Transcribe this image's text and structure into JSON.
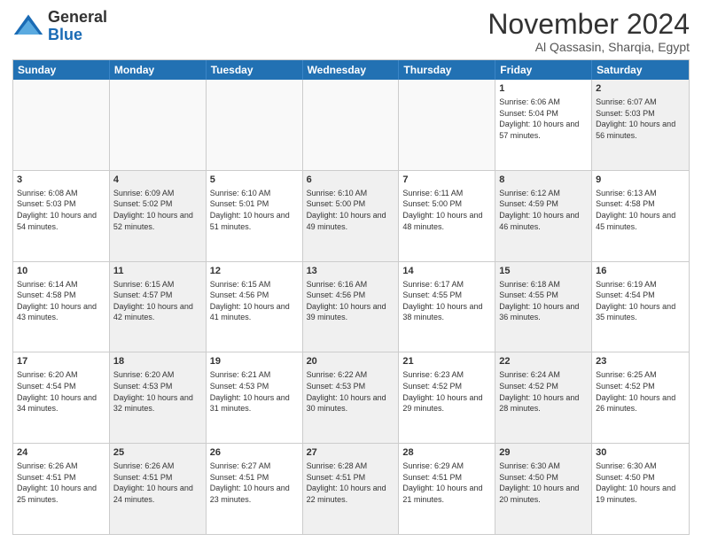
{
  "header": {
    "logo": {
      "general": "General",
      "blue": "Blue"
    },
    "title": "November 2024",
    "subtitle": "Al Qassasin, Sharqia, Egypt"
  },
  "days": [
    "Sunday",
    "Monday",
    "Tuesday",
    "Wednesday",
    "Thursday",
    "Friday",
    "Saturday"
  ],
  "rows": [
    [
      {
        "day": "",
        "empty": true
      },
      {
        "day": "",
        "empty": true
      },
      {
        "day": "",
        "empty": true
      },
      {
        "day": "",
        "empty": true
      },
      {
        "day": "",
        "empty": true
      },
      {
        "day": "1",
        "sunrise": "6:06 AM",
        "sunset": "5:04 PM",
        "daylight": "10 hours and 57 minutes."
      },
      {
        "day": "2",
        "sunrise": "6:07 AM",
        "sunset": "5:03 PM",
        "daylight": "10 hours and 56 minutes.",
        "shaded": true
      }
    ],
    [
      {
        "day": "3",
        "sunrise": "6:08 AM",
        "sunset": "5:03 PM",
        "daylight": "10 hours and 54 minutes."
      },
      {
        "day": "4",
        "sunrise": "6:09 AM",
        "sunset": "5:02 PM",
        "daylight": "10 hours and 52 minutes.",
        "shaded": true
      },
      {
        "day": "5",
        "sunrise": "6:10 AM",
        "sunset": "5:01 PM",
        "daylight": "10 hours and 51 minutes."
      },
      {
        "day": "6",
        "sunrise": "6:10 AM",
        "sunset": "5:00 PM",
        "daylight": "10 hours and 49 minutes.",
        "shaded": true
      },
      {
        "day": "7",
        "sunrise": "6:11 AM",
        "sunset": "5:00 PM",
        "daylight": "10 hours and 48 minutes."
      },
      {
        "day": "8",
        "sunrise": "6:12 AM",
        "sunset": "4:59 PM",
        "daylight": "10 hours and 46 minutes.",
        "shaded": true
      },
      {
        "day": "9",
        "sunrise": "6:13 AM",
        "sunset": "4:58 PM",
        "daylight": "10 hours and 45 minutes."
      }
    ],
    [
      {
        "day": "10",
        "sunrise": "6:14 AM",
        "sunset": "4:58 PM",
        "daylight": "10 hours and 43 minutes."
      },
      {
        "day": "11",
        "sunrise": "6:15 AM",
        "sunset": "4:57 PM",
        "daylight": "10 hours and 42 minutes.",
        "shaded": true
      },
      {
        "day": "12",
        "sunrise": "6:15 AM",
        "sunset": "4:56 PM",
        "daylight": "10 hours and 41 minutes."
      },
      {
        "day": "13",
        "sunrise": "6:16 AM",
        "sunset": "4:56 PM",
        "daylight": "10 hours and 39 minutes.",
        "shaded": true
      },
      {
        "day": "14",
        "sunrise": "6:17 AM",
        "sunset": "4:55 PM",
        "daylight": "10 hours and 38 minutes."
      },
      {
        "day": "15",
        "sunrise": "6:18 AM",
        "sunset": "4:55 PM",
        "daylight": "10 hours and 36 minutes.",
        "shaded": true
      },
      {
        "day": "16",
        "sunrise": "6:19 AM",
        "sunset": "4:54 PM",
        "daylight": "10 hours and 35 minutes."
      }
    ],
    [
      {
        "day": "17",
        "sunrise": "6:20 AM",
        "sunset": "4:54 PM",
        "daylight": "10 hours and 34 minutes."
      },
      {
        "day": "18",
        "sunrise": "6:20 AM",
        "sunset": "4:53 PM",
        "daylight": "10 hours and 32 minutes.",
        "shaded": true
      },
      {
        "day": "19",
        "sunrise": "6:21 AM",
        "sunset": "4:53 PM",
        "daylight": "10 hours and 31 minutes."
      },
      {
        "day": "20",
        "sunrise": "6:22 AM",
        "sunset": "4:53 PM",
        "daylight": "10 hours and 30 minutes.",
        "shaded": true
      },
      {
        "day": "21",
        "sunrise": "6:23 AM",
        "sunset": "4:52 PM",
        "daylight": "10 hours and 29 minutes."
      },
      {
        "day": "22",
        "sunrise": "6:24 AM",
        "sunset": "4:52 PM",
        "daylight": "10 hours and 28 minutes.",
        "shaded": true
      },
      {
        "day": "23",
        "sunrise": "6:25 AM",
        "sunset": "4:52 PM",
        "daylight": "10 hours and 26 minutes."
      }
    ],
    [
      {
        "day": "24",
        "sunrise": "6:26 AM",
        "sunset": "4:51 PM",
        "daylight": "10 hours and 25 minutes."
      },
      {
        "day": "25",
        "sunrise": "6:26 AM",
        "sunset": "4:51 PM",
        "daylight": "10 hours and 24 minutes.",
        "shaded": true
      },
      {
        "day": "26",
        "sunrise": "6:27 AM",
        "sunset": "4:51 PM",
        "daylight": "10 hours and 23 minutes."
      },
      {
        "day": "27",
        "sunrise": "6:28 AM",
        "sunset": "4:51 PM",
        "daylight": "10 hours and 22 minutes.",
        "shaded": true
      },
      {
        "day": "28",
        "sunrise": "6:29 AM",
        "sunset": "4:51 PM",
        "daylight": "10 hours and 21 minutes."
      },
      {
        "day": "29",
        "sunrise": "6:30 AM",
        "sunset": "4:50 PM",
        "daylight": "10 hours and 20 minutes.",
        "shaded": true
      },
      {
        "day": "30",
        "sunrise": "6:30 AM",
        "sunset": "4:50 PM",
        "daylight": "10 hours and 19 minutes."
      }
    ]
  ]
}
